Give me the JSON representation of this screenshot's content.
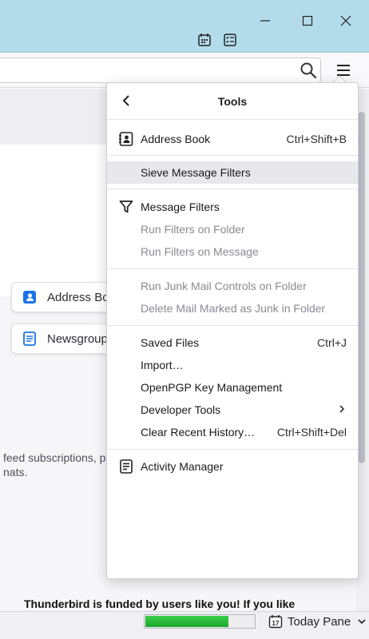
{
  "window": {
    "controls": [
      "minimize-icon",
      "maximize-icon",
      "close-icon"
    ],
    "spaces": [
      "calendar-icon",
      "tasks-icon"
    ]
  },
  "toolbar": {
    "search_icon": "search-icon",
    "menu_icon": "hamburger-menu-icon"
  },
  "background": {
    "cards": [
      {
        "label": "Address Bo",
        "icon": "address-book-icon"
      },
      {
        "label": "Newsgroup",
        "icon": "newsgroup-icon"
      }
    ],
    "text_line1": "feed subscriptions, pr",
    "text_line2": "nats.",
    "footer_text": "Thunderbird is funded by users like you! If you like"
  },
  "statusbar": {
    "progress": 0.75,
    "progress_color": "#2fbd3f",
    "calendar_day": "17",
    "today_pane_label": "Today Pane"
  },
  "menu": {
    "title": "Tools",
    "items": {
      "address_book": {
        "label": "Address Book",
        "shortcut": "Ctrl+Shift+B"
      },
      "sieve": {
        "label": "Sieve Message Filters"
      },
      "message_filters": {
        "label": "Message Filters"
      },
      "run_filters_folder": {
        "label": "Run Filters on Folder"
      },
      "run_filters_message": {
        "label": "Run Filters on Message"
      },
      "junk_controls": {
        "label": "Run Junk Mail Controls on Folder"
      },
      "delete_junk": {
        "label": "Delete Mail Marked as Junk in Folder"
      },
      "saved_files": {
        "label": "Saved Files",
        "shortcut": "Ctrl+J"
      },
      "import": {
        "label": "Import…"
      },
      "openpgp": {
        "label": "OpenPGP Key Management"
      },
      "developer_tools": {
        "label": "Developer Tools"
      },
      "clear_history": {
        "label": "Clear Recent History…",
        "shortcut": "Ctrl+Shift+Del"
      },
      "activity_manager": {
        "label": "Activity Manager"
      }
    }
  }
}
